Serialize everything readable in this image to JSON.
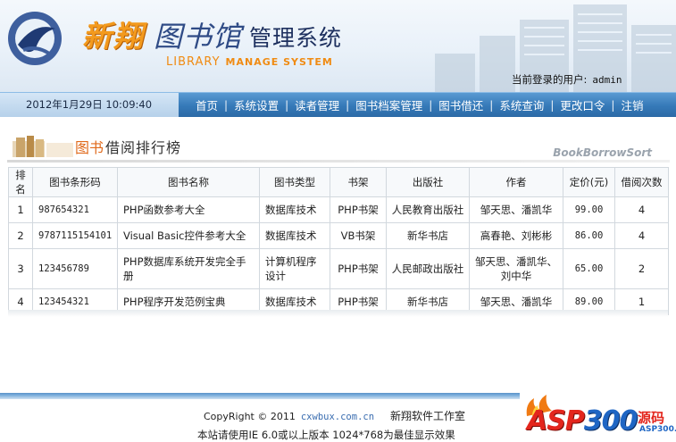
{
  "header": {
    "brand": "新翔",
    "library": "图书馆",
    "system": "管理系统",
    "subtitle_library": "LIBRARY",
    "subtitle_system": "MANAGE SYSTEM",
    "login_label": "当前登录的用户:",
    "login_user": "admin"
  },
  "navbar": {
    "datetime": "2012年1月29日 10:09:40",
    "items": [
      "首页",
      "系统设置",
      "读者管理",
      "图书档案管理",
      "图书借还",
      "系统查询",
      "更改口令",
      "注销"
    ]
  },
  "section": {
    "title_highlight": "图书",
    "title": "借阅排行榜",
    "subtitle_en": "BookBorrowSort"
  },
  "table": {
    "columns": [
      "排名",
      "图书条形码",
      "图书名称",
      "图书类型",
      "书架",
      "出版社",
      "作者",
      "定价(元)",
      "借阅次数"
    ],
    "rows": [
      [
        "1",
        "987654321",
        "PHP函数参考大全",
        "数据库技术",
        "PHP书架",
        "人民教育出版社",
        "邹天思、潘凯华",
        "99.00",
        "4"
      ],
      [
        "2",
        "9787115154101",
        "Visual Basic控件参考大全",
        "数据库技术",
        "VB书架",
        "新华书店",
        "高春艳、刘彬彬",
        "86.00",
        "4"
      ],
      [
        "3",
        "123456789",
        "PHP数据库系统开发完全手册",
        "计算机程序设计",
        "PHP书架",
        "人民邮政出版社",
        "邹天思、潘凯华、刘中华",
        "65.00",
        "2"
      ],
      [
        "4",
        "123454321",
        "PHP程序开发范例宝典",
        "数据库技术",
        "PHP书架",
        "新华书店",
        "邹天思、潘凯华",
        "89.00",
        "1"
      ]
    ]
  },
  "footer": {
    "copyright": "CopyRight © 2011",
    "site": "cxwbux.com.cn",
    "studio": "新翔软件工作室",
    "tip": "本站请使用IE 6.0或以上版本 1024*768为最佳显示效果"
  },
  "watermark": {
    "asp": "ASP",
    "num": "300",
    "cn": "源码",
    "domain": "ASP300.com"
  },
  "colors": {
    "nav_bg": "#3579b8",
    "brand_orange": "#f39a1e",
    "title_navy": "#1d2f5e",
    "section_highlight": "#e06a1c"
  },
  "icons": [
    "library-emblem-icon",
    "book-stack-icon",
    "city-skyline-icon",
    "asp300-logo"
  ]
}
